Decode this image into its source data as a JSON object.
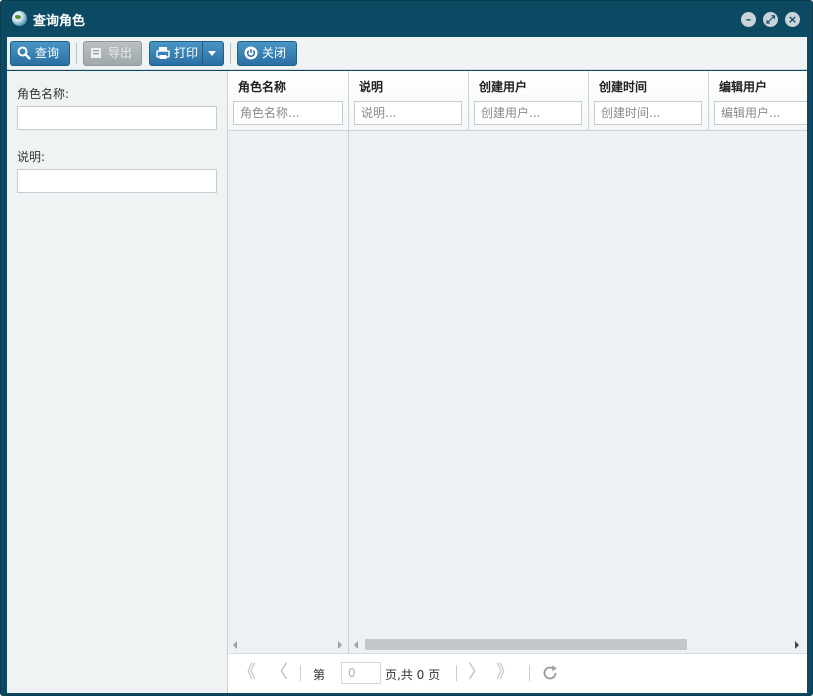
{
  "window": {
    "title": "查询角色"
  },
  "toolbar": {
    "query_label": "查询",
    "export_label": "导出",
    "print_label": "打印",
    "close_label": "关闭"
  },
  "form": {
    "fields": [
      {
        "label": "角色名称:",
        "value": ""
      },
      {
        "label": "说明:",
        "value": ""
      }
    ]
  },
  "grid": {
    "columns": [
      {
        "title": "角色名称",
        "filter_placeholder": "角色名称..."
      },
      {
        "title": "说明",
        "filter_placeholder": "说明..."
      },
      {
        "title": "创建用户",
        "filter_placeholder": "创建用户..."
      },
      {
        "title": "创建时间",
        "filter_placeholder": "创建时间..."
      },
      {
        "title": "编辑用户",
        "filter_placeholder": "编辑用户..."
      }
    ],
    "rows": []
  },
  "pager": {
    "page_prefix": "第",
    "page_value": "0",
    "page_suffix": "页,共 0 页"
  },
  "icons": {
    "title": "globe-icon",
    "query": "search-icon",
    "export": "export-icon",
    "print": "printer-icon",
    "close": "power-icon"
  },
  "colors": {
    "window_frame": "#0c4a63",
    "button_primary": "#2a6fa3",
    "panel_bg": "#f0f3f4"
  }
}
